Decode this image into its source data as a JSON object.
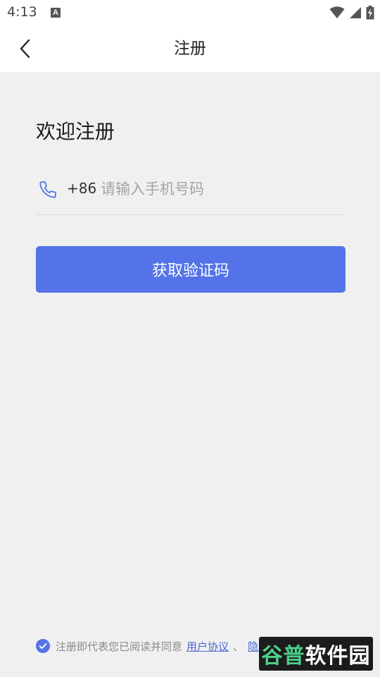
{
  "status_bar": {
    "time": "4:13",
    "notification_glyph": "A",
    "icons": [
      "wifi-icon",
      "cell-signal-icon",
      "battery-charging-icon"
    ]
  },
  "app_bar": {
    "title": "注册",
    "back_icon": "chevron-left-icon"
  },
  "form": {
    "heading": "欢迎注册",
    "phone": {
      "icon": "phone-icon",
      "country_code": "+86",
      "placeholder": "请输入手机号码",
      "value": ""
    },
    "submit_label": "获取验证码"
  },
  "agreement": {
    "checked": true,
    "text": "注册即代表您已阅读并同意",
    "user_agreement_link": "用户协议",
    "separator": "、",
    "privacy_link": "隐私政策"
  },
  "watermark": {
    "part1": "谷普",
    "part2": "软件园"
  },
  "colors": {
    "accent": "#5473e8",
    "link": "#4a67d6",
    "background": "#f0f0f0",
    "surface": "#ffffff"
  }
}
